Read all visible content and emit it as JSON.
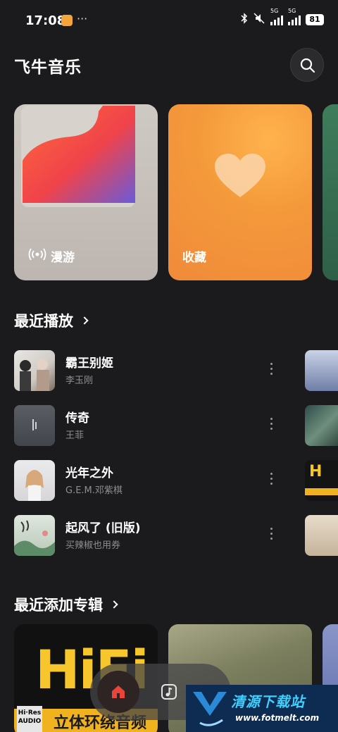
{
  "status_bar": {
    "time": "17:08",
    "more": "···",
    "battery": "81",
    "network_1": "5G",
    "network_2": "5G"
  },
  "header": {
    "title": "飞牛音乐"
  },
  "feature_cards": [
    {
      "label": "漫游"
    },
    {
      "label": "收藏"
    }
  ],
  "recent_played": {
    "title": "最近播放",
    "songs": [
      {
        "title": "霸王别姬",
        "artist": "李玉刚"
      },
      {
        "title": "传奇",
        "artist": "王菲"
      },
      {
        "title": "光年之外",
        "artist": "G.E.M.邓紫棋"
      },
      {
        "title": "起风了 (旧版)",
        "artist": "买辣椒也用券"
      }
    ]
  },
  "recent_albums": {
    "title": "最近添加专辑",
    "albums": [
      {
        "cover_text": "HiFi",
        "subtitle": "立体环绕音频",
        "badge_top": "Hi·Res",
        "badge_bottom": "AUDIO"
      }
    ]
  },
  "watermark": {
    "text": "清源下载站",
    "url": "www.fotmelt.com"
  },
  "colors": {
    "background": "#1b1b1d",
    "fav_card": "#f49a3b",
    "hifi_yellow": "#f7c52c",
    "home_active": "#e8463a"
  }
}
